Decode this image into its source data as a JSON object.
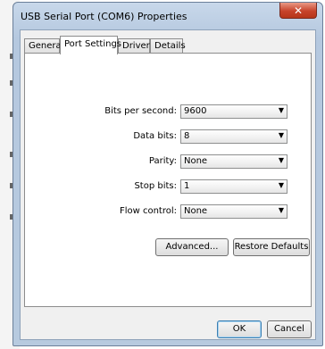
{
  "window": {
    "title": "USB Serial Port (COM6) Properties",
    "close_glyph": "✕"
  },
  "tabs": [
    {
      "label": "General",
      "active": false
    },
    {
      "label": "Port Settings",
      "active": true
    },
    {
      "label": "Driver",
      "active": false
    },
    {
      "label": "Details",
      "active": false
    }
  ],
  "fields": [
    {
      "label": "Bits per second:",
      "value": "9600"
    },
    {
      "label": "Data bits:",
      "value": "8"
    },
    {
      "label": "Parity:",
      "value": "None"
    },
    {
      "label": "Stop bits:",
      "value": "1"
    },
    {
      "label": "Flow control:",
      "value": "None"
    }
  ],
  "buttons": {
    "advanced": "Advanced...",
    "restore_defaults": "Restore Defaults",
    "ok": "OK",
    "cancel": "Cancel"
  },
  "icons": {
    "dropdown": "▼"
  }
}
